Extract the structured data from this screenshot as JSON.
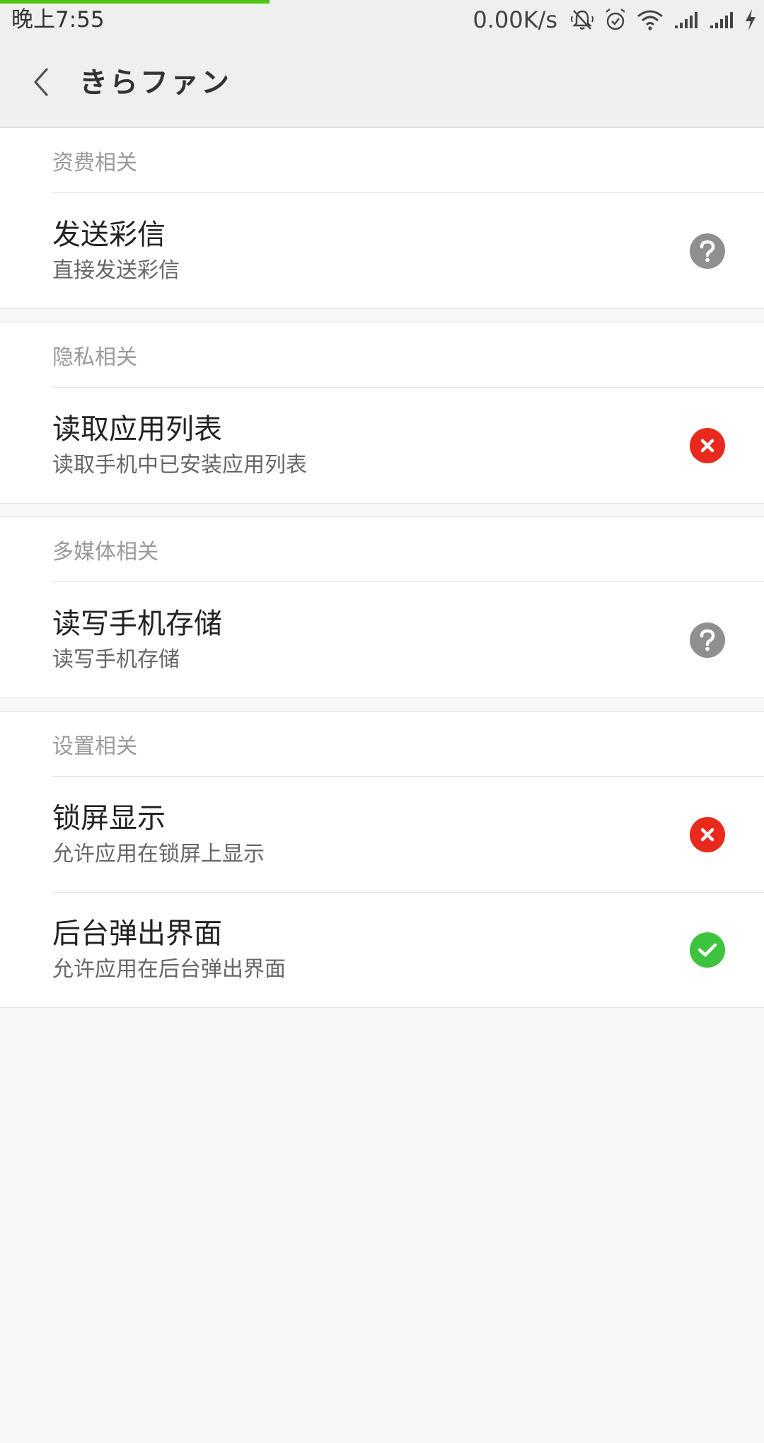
{
  "statusbar": {
    "time": "晚上7:55",
    "net_speed": "0.00K/s",
    "load_progress": 0.353,
    "icons": [
      "mute-bell-icon",
      "alarm-icon",
      "wifi-icon",
      "signal-icon",
      "signal-icon",
      "charging-icon"
    ]
  },
  "titlebar": {
    "title": "きらファン",
    "back_icon": "chevron-left-icon"
  },
  "colors": {
    "accent_progress": "#4fc411",
    "status_unknown": "#8f8f8f",
    "status_denied": "#e8291c",
    "status_allowed": "#3dc33d"
  },
  "sections": [
    {
      "header": "资费相关",
      "items": [
        {
          "title": "发送彩信",
          "desc": "直接发送彩信",
          "status": "unknown"
        }
      ]
    },
    {
      "header": "隐私相关",
      "items": [
        {
          "title": "读取应用列表",
          "desc": "读取手机中已安装应用列表",
          "status": "denied"
        }
      ]
    },
    {
      "header": "多媒体相关",
      "items": [
        {
          "title": "读写手机存储",
          "desc": "读写手机存储",
          "status": "unknown"
        }
      ]
    },
    {
      "header": "设置相关",
      "items": [
        {
          "title": "锁屏显示",
          "desc": "允许应用在锁屏上显示",
          "status": "denied"
        },
        {
          "title": "后台弹出界面",
          "desc": "允许应用在后台弹出界面",
          "status": "allowed"
        }
      ]
    }
  ]
}
